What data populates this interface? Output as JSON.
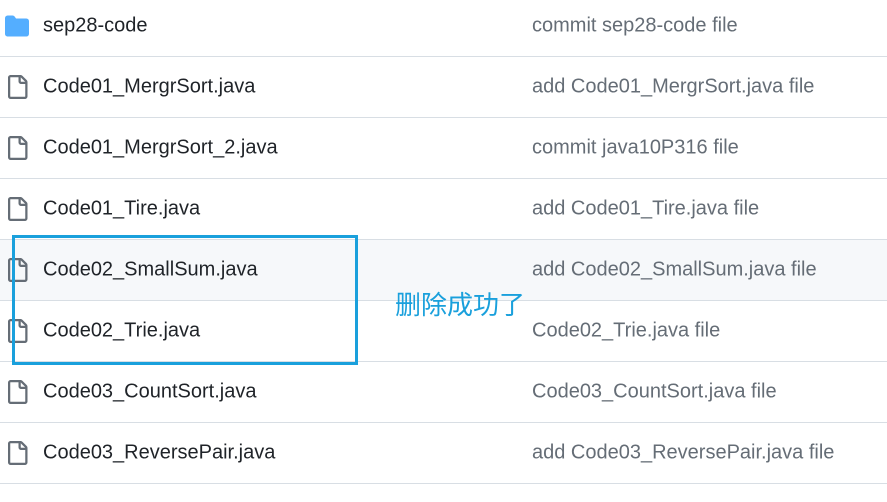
{
  "colors": {
    "folder_icon": "#54aeff",
    "file_icon": "#656d76",
    "name_text": "#1f2328",
    "message_text": "#656d76",
    "separator": "#d8dee4",
    "hover_row_bg": "#f6f8fa",
    "annotation": "#1aa0dc"
  },
  "rows": [
    {
      "icon": "folder-icon",
      "name": "sep28-code",
      "message": "commit sep28-code file",
      "hovered": false
    },
    {
      "icon": "file-icon",
      "name": "Code01_MergrSort.java",
      "message": "add Code01_MergrSort.java file",
      "hovered": false
    },
    {
      "icon": "file-icon",
      "name": "Code01_MergrSort_2.java",
      "message": "commit java10P316 file",
      "hovered": false
    },
    {
      "icon": "file-icon",
      "name": "Code01_Tire.java",
      "message": "add Code01_Tire.java file",
      "hovered": false
    },
    {
      "icon": "file-icon",
      "name": "Code02_SmallSum.java",
      "message": "add Code02_SmallSum.java file",
      "hovered": true
    },
    {
      "icon": "file-icon",
      "name": "Code02_Trie.java",
      "message": "Code02_Trie.java file",
      "hovered": false
    },
    {
      "icon": "file-icon",
      "name": "Code03_CountSort.java",
      "message": "Code03_CountSort.java file",
      "hovered": false
    },
    {
      "icon": "file-icon",
      "name": "Code03_ReversePair.java",
      "message": "add Code03_ReversePair.java file",
      "hovered": false
    }
  ],
  "annotation": {
    "text": "删除成功了"
  }
}
